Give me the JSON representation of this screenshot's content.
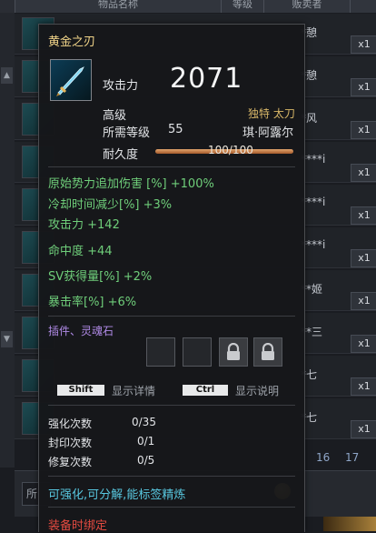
{
  "market": {
    "header": {
      "item_name": "物品名称",
      "level": "等级",
      "seller": "贩卖者"
    },
    "rows": [
      {
        "seller": "*憩",
        "qty": "x1"
      },
      {
        "seller": "*憩",
        "qty": "x1"
      },
      {
        "seller": "*风",
        "qty": "x1"
      },
      {
        "seller": "****i",
        "qty": "x1"
      },
      {
        "seller": "****i",
        "qty": "x1"
      },
      {
        "seller": "****i",
        "qty": "x1"
      },
      {
        "seller": "**姬",
        "qty": "x1"
      },
      {
        "seller": "**三",
        "qty": "x1"
      },
      {
        "seller": "*七",
        "qty": "x1"
      },
      {
        "seller": "*七",
        "qty": "x1"
      }
    ],
    "pager": {
      "p16": "16",
      "p17": "17"
    },
    "search_prefix": "所"
  },
  "tooltip": {
    "name": "黄金之刃",
    "attack_label": "攻击力",
    "attack_value": "2071",
    "grade": "高级",
    "rarity": "独特 太刀",
    "req_level_label": "所需等级",
    "req_level": "55",
    "class_name": "琪·阿露尔",
    "durability_label": "耐久度",
    "durability": "100/100",
    "durability_fraction": 1.0,
    "stats": [
      "原始势力追加伤害 [%] +100%",
      "冷却时间减少[%] +3%",
      "攻击力 +142",
      "命中度 +44",
      "SV获得量[%] +2%",
      "暴击率[%] +6%"
    ],
    "socket_label": "插件、灵魂石",
    "keys": {
      "shift": "Shift",
      "shift_desc": "显示详情",
      "ctrl": "Ctrl",
      "ctrl_desc": "显示说明"
    },
    "counters": [
      {
        "label": "强化次数",
        "value": "0/35"
      },
      {
        "label": "封印次数",
        "value": "0/1"
      },
      {
        "label": "修复次数",
        "value": "0/5"
      }
    ],
    "traits": {
      "part1": "可强化",
      "sep1": ",",
      "part2": "可分解",
      "sep2": ",",
      "part3": "能标签精炼"
    },
    "binding": "装备时绑定"
  },
  "colors": {
    "title_gold": "#f1d489",
    "stat_green": "#6fce7a",
    "trait_cyan": "#58c7df",
    "socket_purple": "#b08ae6",
    "binding_red": "#e24a40"
  }
}
